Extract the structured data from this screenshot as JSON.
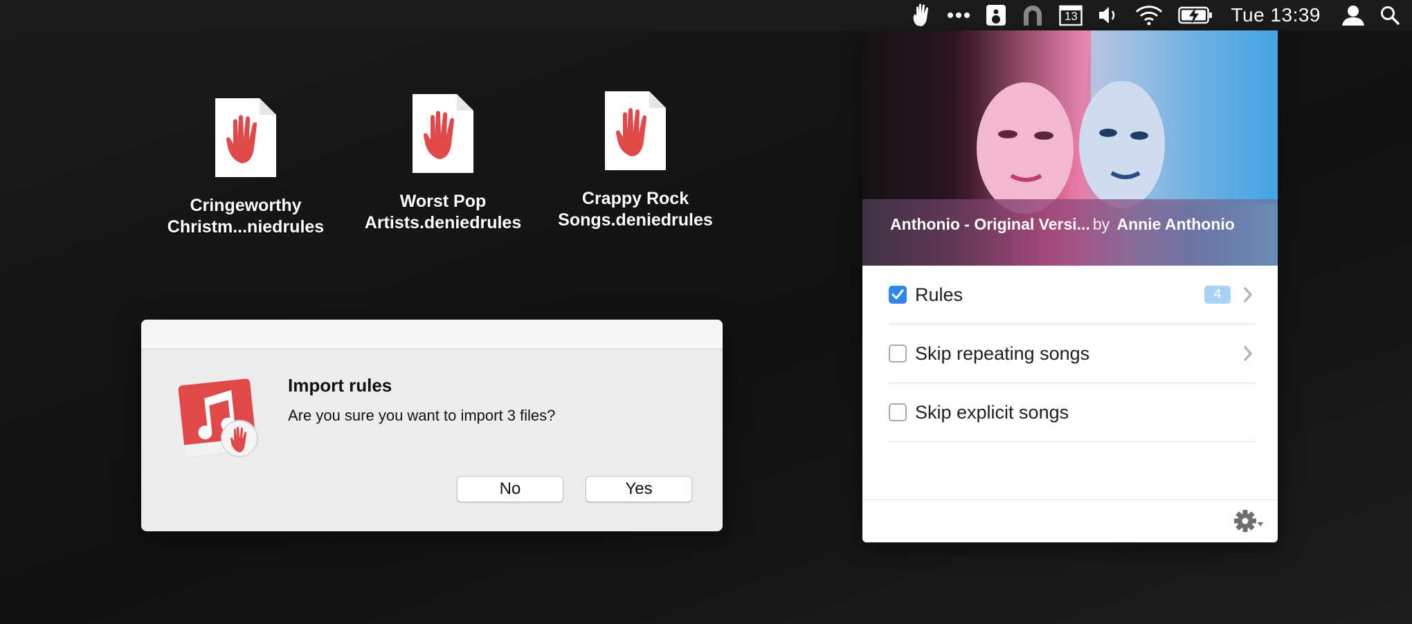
{
  "menubar": {
    "clock": "Tue 13:39",
    "calendar_day": "13",
    "icons": [
      "denied-hand-icon",
      "more-dots-icon",
      "speaker-box-icon",
      "magnet-icon",
      "calendar-icon",
      "volume-icon",
      "wifi-icon",
      "battery-charging-icon",
      "user-icon",
      "spotlight-search-icon"
    ]
  },
  "desktop_files": [
    {
      "line1": "Cringeworthy",
      "line2": "Christm...niedrules"
    },
    {
      "line1": "Worst Pop",
      "line2": "Artists.deniedrules"
    },
    {
      "line1": "Crappy Rock",
      "line2": "Songs.deniedrules"
    }
  ],
  "dialog": {
    "title": "Import rules",
    "message": "Are you sure you want to import 3 files?",
    "no_label": "No",
    "yes_label": "Yes"
  },
  "now_playing": {
    "title": "Anthonio - Original Versi...",
    "by": "by",
    "artist": "Annie Anthonio"
  },
  "options": [
    {
      "label": "Rules",
      "checked": true,
      "badge": "4",
      "has_chevron": true
    },
    {
      "label": "Skip repeating songs",
      "checked": false,
      "has_chevron": true
    },
    {
      "label": "Skip explicit songs",
      "checked": false,
      "has_chevron": false
    }
  ],
  "colors": {
    "accent": "#2f87e8",
    "badge": "#a8d2f7",
    "app_red": "#e0494a"
  }
}
